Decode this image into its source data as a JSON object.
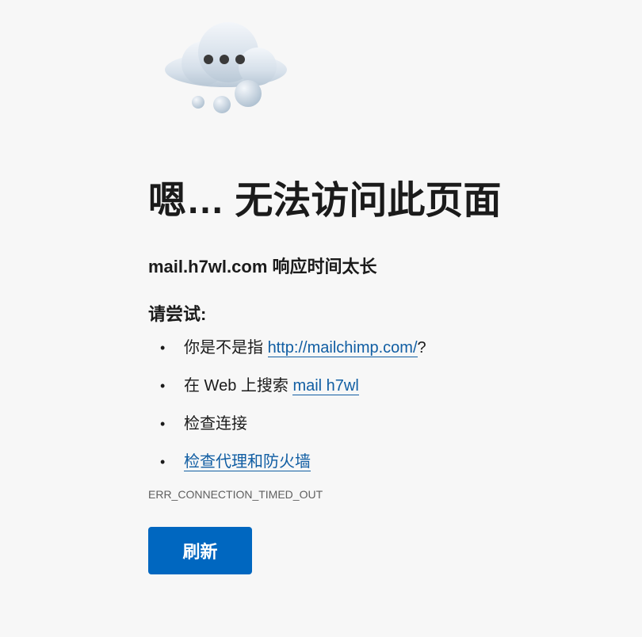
{
  "page": {
    "title": "嗯… 无法访问此页面",
    "subtitle": "mail.h7wl.com 响应时间太长",
    "try_label": "请尝试:",
    "icon": "cloud-thinking-icon"
  },
  "suggestions": [
    {
      "prefix": "你是不是指 ",
      "link": "http://mailchimp.com/",
      "suffix": "?"
    },
    {
      "prefix": "在 Web 上搜索 ",
      "link": "mail h7wl",
      "suffix": ""
    },
    {
      "prefix": "检查连接",
      "link": "",
      "suffix": ""
    },
    {
      "prefix": "",
      "link": "检查代理和防火墙",
      "suffix": ""
    }
  ],
  "bullet": "•",
  "error_code": "ERR_CONNECTION_TIMED_OUT",
  "refresh_button": "刷新",
  "colors": {
    "background": "#f7f7f7",
    "link": "#115ea3",
    "button": "#0067c0",
    "error_text": "#5f5f5f"
  }
}
